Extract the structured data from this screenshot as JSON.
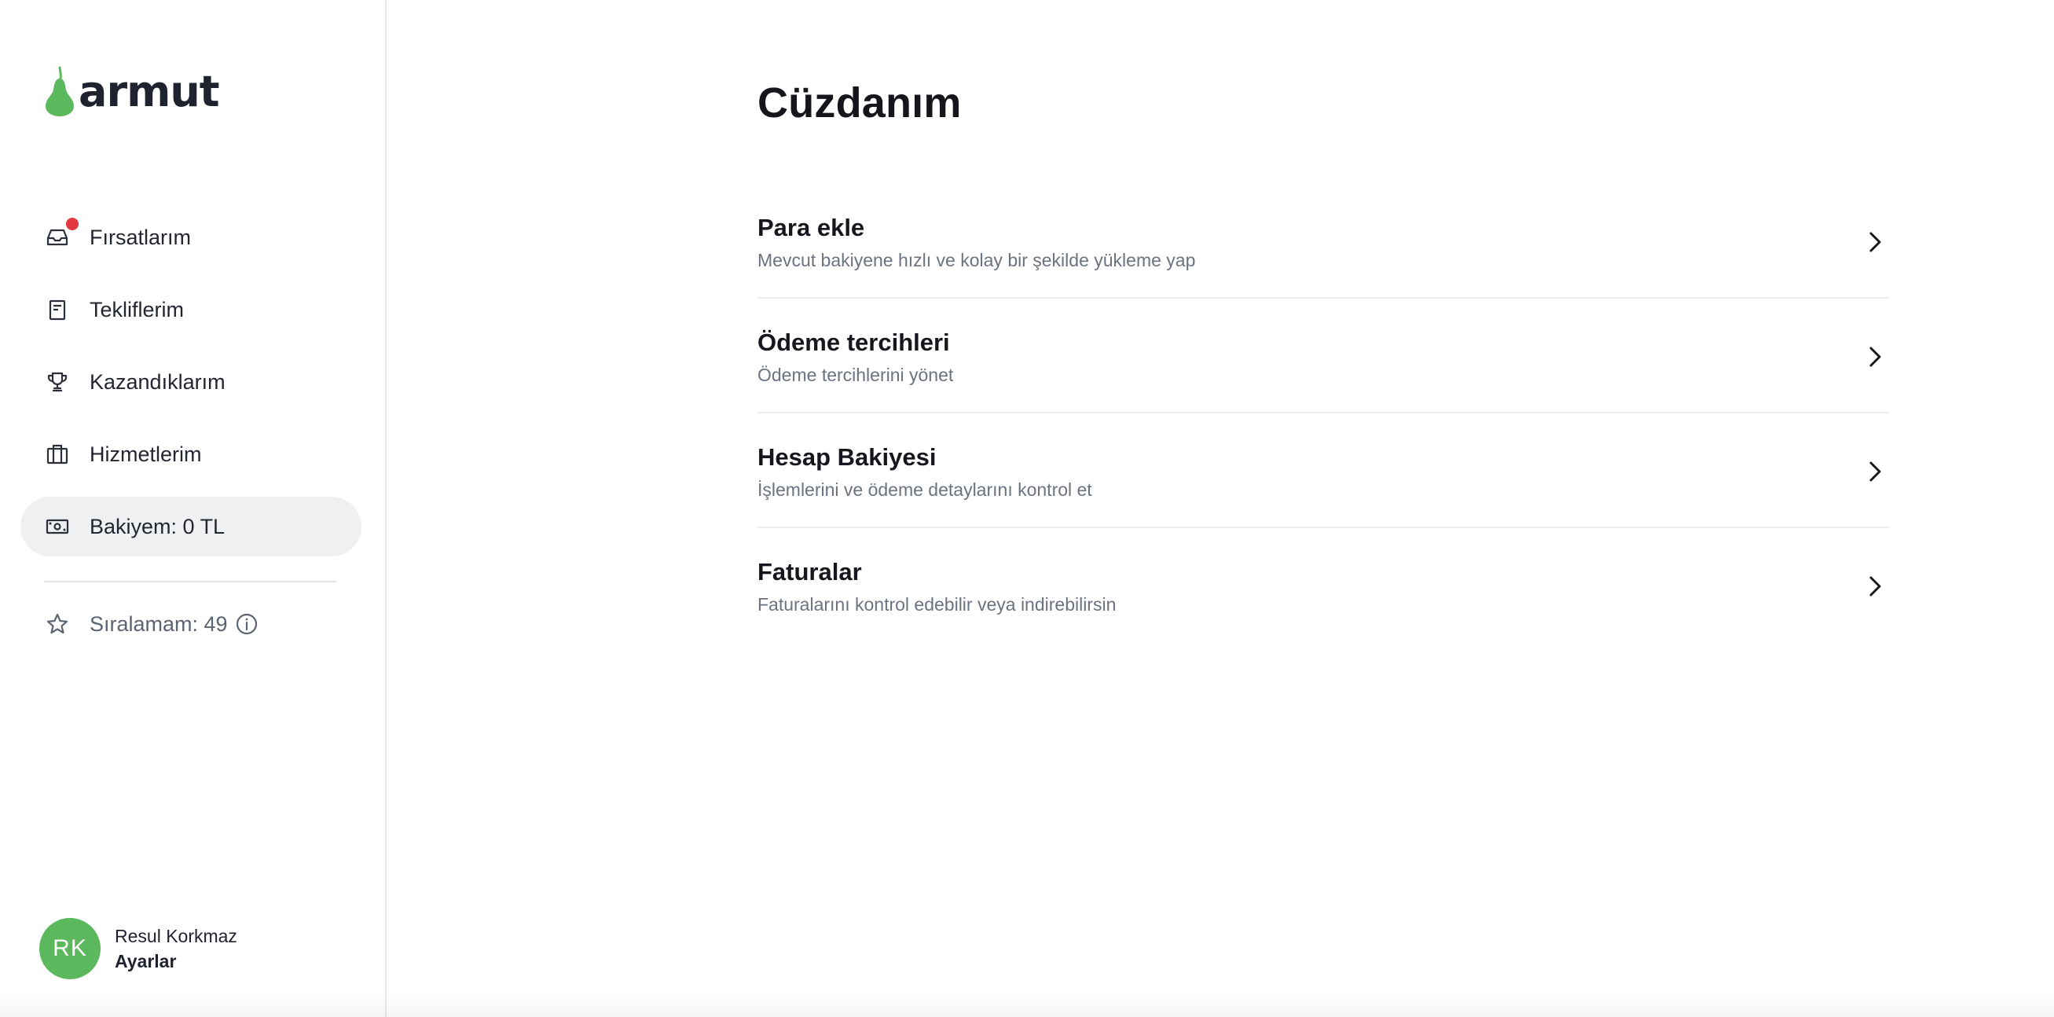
{
  "brand": {
    "name": "armut",
    "accent": "#5cb85c"
  },
  "sidebar": {
    "items": [
      {
        "label": "Fırsatlarım",
        "icon": "inbox-icon",
        "has_badge": true
      },
      {
        "label": "Tekliflerim",
        "icon": "document-icon"
      },
      {
        "label": "Kazandıklarım",
        "icon": "trophy-icon"
      },
      {
        "label": "Hizmetlerim",
        "icon": "briefcase-icon"
      },
      {
        "label": "Bakiyem: 0 TL",
        "icon": "money-icon",
        "active": true
      }
    ],
    "ranking": {
      "label": "Sıralamam: 49",
      "icon": "star-icon",
      "info_icon": "info-icon"
    }
  },
  "user": {
    "initials": "RK",
    "name": "Resul Korkmaz",
    "settings_label": "Ayarlar"
  },
  "main": {
    "title": "Cüzdanım",
    "menu": [
      {
        "title": "Para ekle",
        "subtitle": "Mevcut bakiyene hızlı ve kolay bir şekilde yükleme yap"
      },
      {
        "title": "Ödeme tercihleri",
        "subtitle": "Ödeme tercihlerini yönet"
      },
      {
        "title": "Hesap Bakiyesi",
        "subtitle": "İşlemlerini ve ödeme detaylarını kontrol et"
      },
      {
        "title": "Faturalar",
        "subtitle": "Faturalarını kontrol edebilir veya indirebilirsin"
      }
    ]
  }
}
